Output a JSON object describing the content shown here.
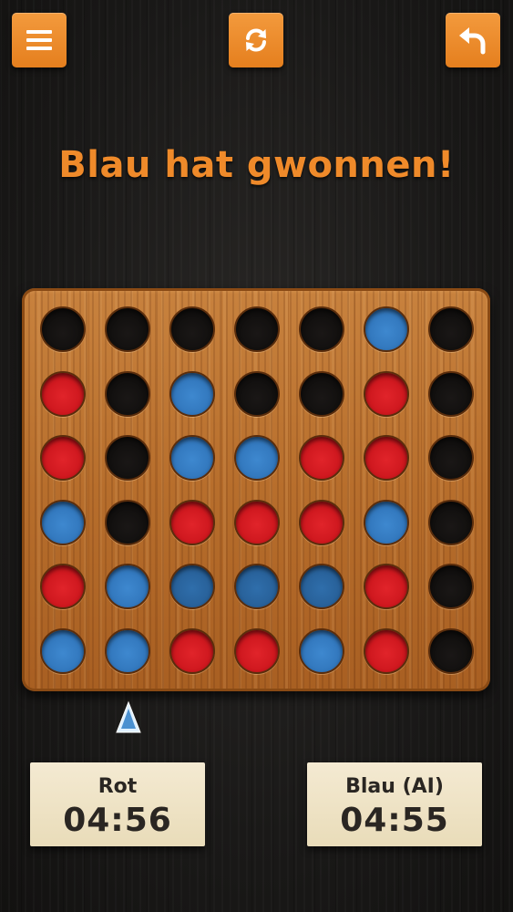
{
  "toolbar": {
    "menu_icon": "hamburger-menu-icon",
    "restart_icon": "refresh-icon",
    "undo_icon": "undo-arrow-icon",
    "button_color": "#ef8a2a"
  },
  "status": {
    "message": "Blau hat gwonnen!",
    "color": "#ef8a2a"
  },
  "board": {
    "columns": 7,
    "rows": 6,
    "cells": [
      [
        "empty",
        "empty",
        "empty",
        "empty",
        "empty",
        "blue",
        "empty"
      ],
      [
        "red",
        "empty",
        "blue",
        "empty",
        "empty",
        "red",
        "empty"
      ],
      [
        "red",
        "empty",
        "blue",
        "blue",
        "red",
        "red",
        "empty"
      ],
      [
        "blue",
        "empty",
        "red",
        "red",
        "red",
        "blue",
        "empty"
      ],
      [
        "red",
        "blue",
        "win",
        "win",
        "win",
        "red",
        "empty"
      ],
      [
        "blue",
        "blue",
        "red",
        "red",
        "blue",
        "red",
        "empty"
      ]
    ],
    "colors": {
      "red": "#d11a20",
      "blue": "#3279c0",
      "winning_blue": "#2a6399",
      "board_wood": "#b76e2c"
    }
  },
  "drop_marker": {
    "column": 2,
    "icon": "triangle-pointer-icon",
    "color": "#4a90d0"
  },
  "players": [
    {
      "name": "Rot",
      "time": "04:56"
    },
    {
      "name": "Blau (AI)",
      "time": "04:55"
    }
  ]
}
